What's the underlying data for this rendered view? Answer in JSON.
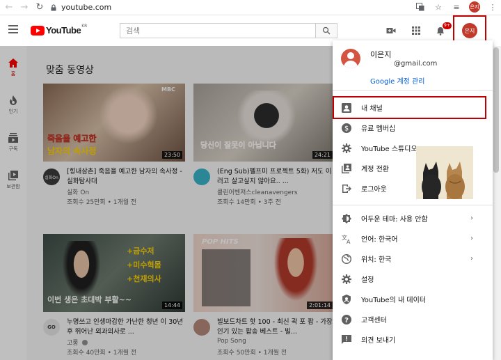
{
  "browser": {
    "url": "youtube.com",
    "avatar_text": "은지"
  },
  "header": {
    "logo_text": "YouTube",
    "logo_region": "KR",
    "search_placeholder": "검색",
    "notification_count": "9+",
    "avatar_text": "은지"
  },
  "guide": {
    "items": [
      {
        "label": "홈",
        "icon": "home-icon"
      },
      {
        "label": "인기",
        "icon": "fire-icon"
      },
      {
        "label": "구독",
        "icon": "subscriptions-icon"
      },
      {
        "label": "보관함",
        "icon": "library-icon"
      }
    ]
  },
  "feed": {
    "section_title": "맞춤 동영상",
    "videos": [
      {
        "title": "[힝내삼촌] 죽음을 예고한 남자의 속사정 - 실화탐사대",
        "channel": "실화 On",
        "meta": "조회수 25만회 • 1개월 전",
        "duration": "23:50",
        "thumb_line1": "죽음을 예고한",
        "thumb_line2": "남자의 속사정",
        "thumb_tag": "MBC",
        "channel_avatar_text": "실화On"
      },
      {
        "title": "(Eng Sub)펠프미 프로젝트 5화) 저도 이러고 살고싶지 않아요.. ...",
        "channel": "클린어벤져스cleanavengers",
        "meta": "조회수 14만회 • 3주 전",
        "duration": "24:21",
        "thumb_line1": "당신이 잘못이 아닙니다",
        "channel_avatar_text": ""
      },
      {
        "title": "누명쓰고 인생마감한 가난한 청년 이 30년 후 뛰어난 외과의사로 ...",
        "channel": "고롱",
        "meta": "조회수 40만회 • 1개월 전",
        "duration": "14:44",
        "thumb_line1": "+금수저",
        "thumb_line2": "+미수혁몸",
        "thumb_line3": "+천재의사",
        "thumb_line4": "이번 생은 초대박 부활~~",
        "channel_avatar_text": "GO"
      },
      {
        "title": "빌보드차트 핫 100 - 최신 곽 포 팝 - 가장 인기 있는 팝송 베스트 - 빌...",
        "channel": "Pop Song",
        "meta": "조회수 50만회 • 1개월 전",
        "duration": "2:01:14",
        "thumb_line1": "POP HITS",
        "channel_avatar_text": ""
      }
    ]
  },
  "menu": {
    "account_name": "이은지",
    "account_email": "@gmail.com",
    "manage_account": "Google 계정 관리",
    "items_1": [
      {
        "label": "내 채널",
        "icon": "account-box-icon"
      },
      {
        "label": "유료 멤버십",
        "icon": "dollar-icon"
      },
      {
        "label": "YouTube 스튜디오",
        "icon": "gear-icon"
      },
      {
        "label": "계정 전환",
        "icon": "switch-account-icon"
      },
      {
        "label": "로그아웃",
        "icon": "sign-out-icon"
      }
    ],
    "items_2": [
      {
        "label": "어두운 테마: 사용 안함",
        "icon": "dark-theme-icon",
        "arrow": "›"
      },
      {
        "label": "언어: 한국어",
        "icon": "translate-icon",
        "arrow": "›"
      },
      {
        "label": "위치: 한국",
        "icon": "globe-icon",
        "arrow": "›"
      },
      {
        "label": "설정",
        "icon": "settings-icon"
      },
      {
        "label": "YouTube의 내 데이터",
        "icon": "shield-icon"
      },
      {
        "label": "고객센터",
        "icon": "help-icon"
      },
      {
        "label": "의견 보내기",
        "icon": "feedback-icon"
      }
    ]
  },
  "colors": {
    "accent": "#ff0000",
    "highlight_box": "#c00000",
    "link": "#065fd4"
  }
}
